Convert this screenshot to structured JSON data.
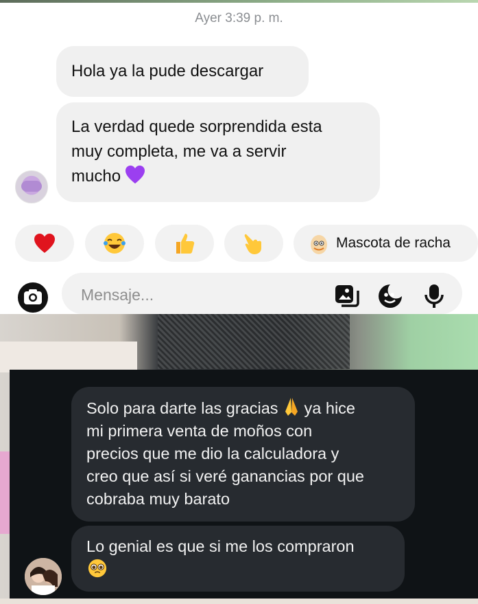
{
  "chat_top": {
    "timestamp": "Ayer 3:39 p. m.",
    "messages": [
      {
        "text": "Hola ya la pude descargar"
      },
      {
        "lines": [
          "La verdad quede sorprendida esta",
          "muy completa, me va a servir",
          "mucho"
        ],
        "emoji": "purple-heart"
      }
    ],
    "reactions": [
      {
        "icon": "red-heart-icon"
      },
      {
        "icon": "laughing-tears-icon"
      },
      {
        "icon": "thumbs-up-icon"
      },
      {
        "icon": "pointing-hand-icon"
      },
      {
        "icon": "egg-mascot-icon",
        "label": "Mascota de racha"
      }
    ],
    "composer": {
      "placeholder": "Mensaje..."
    }
  },
  "chat_bottom": {
    "messages": [
      {
        "lines": [
          "Solo para darte las gracias",
          "mi primera venta  de moños con",
          "precios  que me dio la calculadora y",
          "creo que así si veré ganancias por que",
          "cobraba muy barato"
        ],
        "line1_suffix": "ya hice",
        "emoji": "praying-hands"
      },
      {
        "text": "Lo genial es que si me los compraron",
        "emoji": "pleading-face"
      }
    ]
  },
  "colors": {
    "light_bubble": "#f0f0f0",
    "dark_bubble": "#272b30",
    "dark_panel": "#0f1316"
  }
}
